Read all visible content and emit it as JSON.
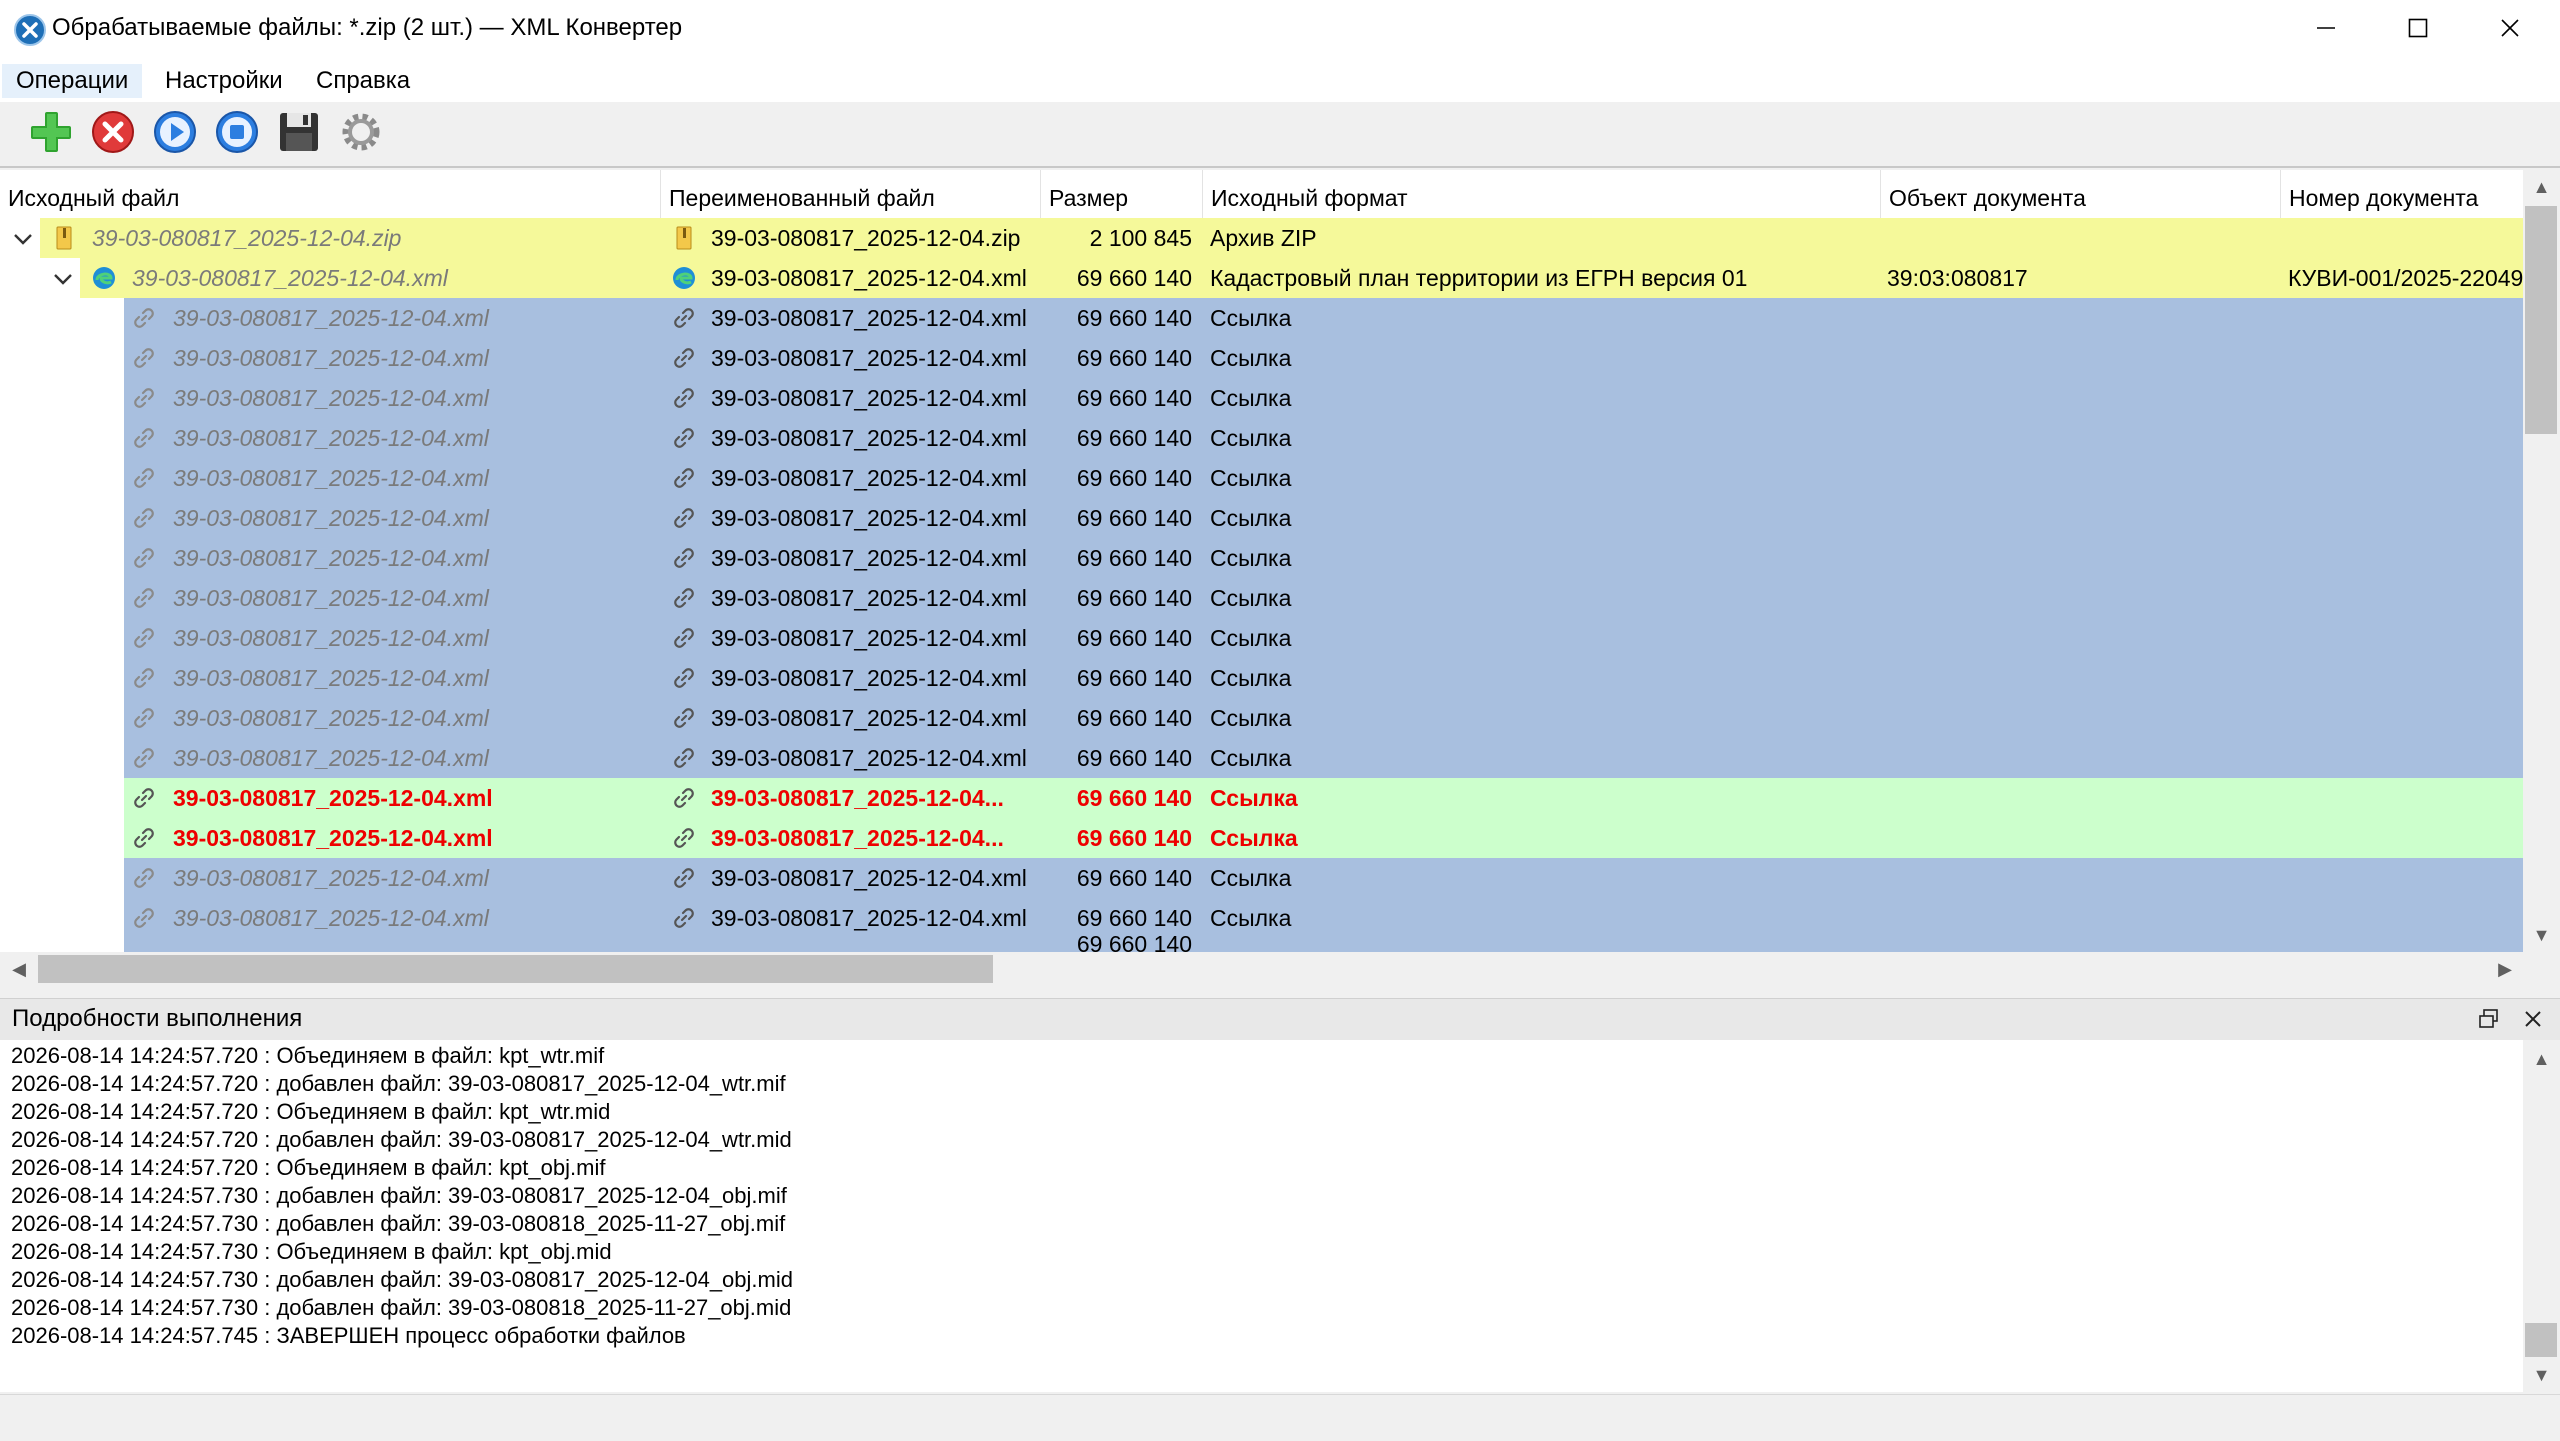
{
  "window": {
    "title": "Обрабатываемые файлы: *.zip (2 шт.) — XML Конвертер",
    "minimize_glyph": "—",
    "maximize_glyph": "☐",
    "close_glyph": "✕"
  },
  "menu": {
    "operations": "Операции",
    "settings": "Настройки",
    "help": "Справка"
  },
  "toolbar": {
    "icons": [
      "add-icon",
      "delete-icon",
      "play-icon",
      "stop-icon",
      "save-icon",
      "settings-icon"
    ]
  },
  "grid": {
    "columns": [
      "Исходный файл",
      "Переименованный файл",
      "Размер",
      "Исходный формат",
      "Объект документа",
      "Номер документа"
    ],
    "zip_row": {
      "source": "39-03-080817_2025-12-04.zip",
      "renamed": "39-03-080817_2025-12-04.zip",
      "size": "2 100 845",
      "format": "Архив ZIP"
    },
    "xml_row": {
      "source": "39-03-080817_2025-12-04.xml",
      "renamed": "39-03-080817_2025-12-04.xml",
      "size": "69 660 140",
      "format": "Кадастровый план территории из ЕГРН версия 01",
      "object": "39:03:080817",
      "number": "КУВИ-001/2025-22049"
    },
    "link_rows": [
      {
        "source": "39-03-080817_2025-12-04.xml",
        "renamed": "39-03-080817_2025-12-04.xml",
        "size": "69 660 140",
        "format": "Ссылка",
        "state": "normal"
      },
      {
        "source": "39-03-080817_2025-12-04.xml",
        "renamed": "39-03-080817_2025-12-04.xml",
        "size": "69 660 140",
        "format": "Ссылка",
        "state": "normal"
      },
      {
        "source": "39-03-080817_2025-12-04.xml",
        "renamed": "39-03-080817_2025-12-04.xml",
        "size": "69 660 140",
        "format": "Ссылка",
        "state": "normal"
      },
      {
        "source": "39-03-080817_2025-12-04.xml",
        "renamed": "39-03-080817_2025-12-04.xml",
        "size": "69 660 140",
        "format": "Ссылка",
        "state": "normal"
      },
      {
        "source": "39-03-080817_2025-12-04.xml",
        "renamed": "39-03-080817_2025-12-04.xml",
        "size": "69 660 140",
        "format": "Ссылка",
        "state": "normal"
      },
      {
        "source": "39-03-080817_2025-12-04.xml",
        "renamed": "39-03-080817_2025-12-04.xml",
        "size": "69 660 140",
        "format": "Ссылка",
        "state": "normal"
      },
      {
        "source": "39-03-080817_2025-12-04.xml",
        "renamed": "39-03-080817_2025-12-04.xml",
        "size": "69 660 140",
        "format": "Ссылка",
        "state": "normal"
      },
      {
        "source": "39-03-080817_2025-12-04.xml",
        "renamed": "39-03-080817_2025-12-04.xml",
        "size": "69 660 140",
        "format": "Ссылка",
        "state": "normal"
      },
      {
        "source": "39-03-080817_2025-12-04.xml",
        "renamed": "39-03-080817_2025-12-04.xml",
        "size": "69 660 140",
        "format": "Ссылка",
        "state": "normal"
      },
      {
        "source": "39-03-080817_2025-12-04.xml",
        "renamed": "39-03-080817_2025-12-04.xml",
        "size": "69 660 140",
        "format": "Ссылка",
        "state": "normal"
      },
      {
        "source": "39-03-080817_2025-12-04.xml",
        "renamed": "39-03-080817_2025-12-04.xml",
        "size": "69 660 140",
        "format": "Ссылка",
        "state": "normal"
      },
      {
        "source": "39-03-080817_2025-12-04.xml",
        "renamed": "39-03-080817_2025-12-04.xml",
        "size": "69 660 140",
        "format": "Ссылка",
        "state": "normal"
      },
      {
        "source": "39-03-080817_2025-12-04.xml",
        "renamed": "39-03-080817_2025-12-04...",
        "size": "69 660 140",
        "format": "Ссылка",
        "state": "highlight"
      },
      {
        "source": "39-03-080817_2025-12-04.xml",
        "renamed": "39-03-080817_2025-12-04...",
        "size": "69 660 140",
        "format": "Ссылка",
        "state": "highlight"
      },
      {
        "source": "39-03-080817_2025-12-04.xml",
        "renamed": "39-03-080817_2025-12-04.xml",
        "size": "69 660 140",
        "format": "Ссылка",
        "state": "normal"
      },
      {
        "source": "39-03-080817_2025-12-04.xml",
        "renamed": "39-03-080817_2025-12-04.xml",
        "size": "69 660 140",
        "format": "Ссылка",
        "state": "normal"
      },
      {
        "source": "",
        "renamed": "",
        "size": "69 660 140",
        "format": "",
        "state": "normal"
      }
    ]
  },
  "log": {
    "title": "Подробности выполнения",
    "lines": [
      "2026-08-14 14:24:57.720 : Объединяем в файл: kpt_wtr.mif",
      "2026-08-14 14:24:57.720 : добавлен файл: 39-03-080817_2025-12-04_wtr.mif",
      "2026-08-14 14:24:57.720 : Объединяем в файл: kpt_wtr.mid",
      "2026-08-14 14:24:57.720 : добавлен файл: 39-03-080817_2025-12-04_wtr.mid",
      "2026-08-14 14:24:57.720 : Объединяем в файл: kpt_obj.mif",
      "2026-08-14 14:24:57.730 : добавлен файл: 39-03-080817_2025-12-04_obj.mif",
      "2026-08-14 14:24:57.730 : добавлен файл: 39-03-080818_2025-11-27_obj.mif",
      "2026-08-14 14:24:57.730 : Объединяем в файл: kpt_obj.mid",
      "2026-08-14 14:24:57.730 : добавлен файл: 39-03-080817_2025-12-04_obj.mid",
      "2026-08-14 14:24:57.730 : добавлен файл: 39-03-080818_2025-11-27_obj.mid",
      "2026-08-14 14:24:57.745 : ЗАВЕРШЕН процесс обработки файлов"
    ]
  },
  "colors": {
    "zip_row_bg": "#f5f99a",
    "link_row_bg": "#a8bfdf",
    "highlight_row_bg": "#ccffcc",
    "highlight_text": "#ee0000"
  }
}
